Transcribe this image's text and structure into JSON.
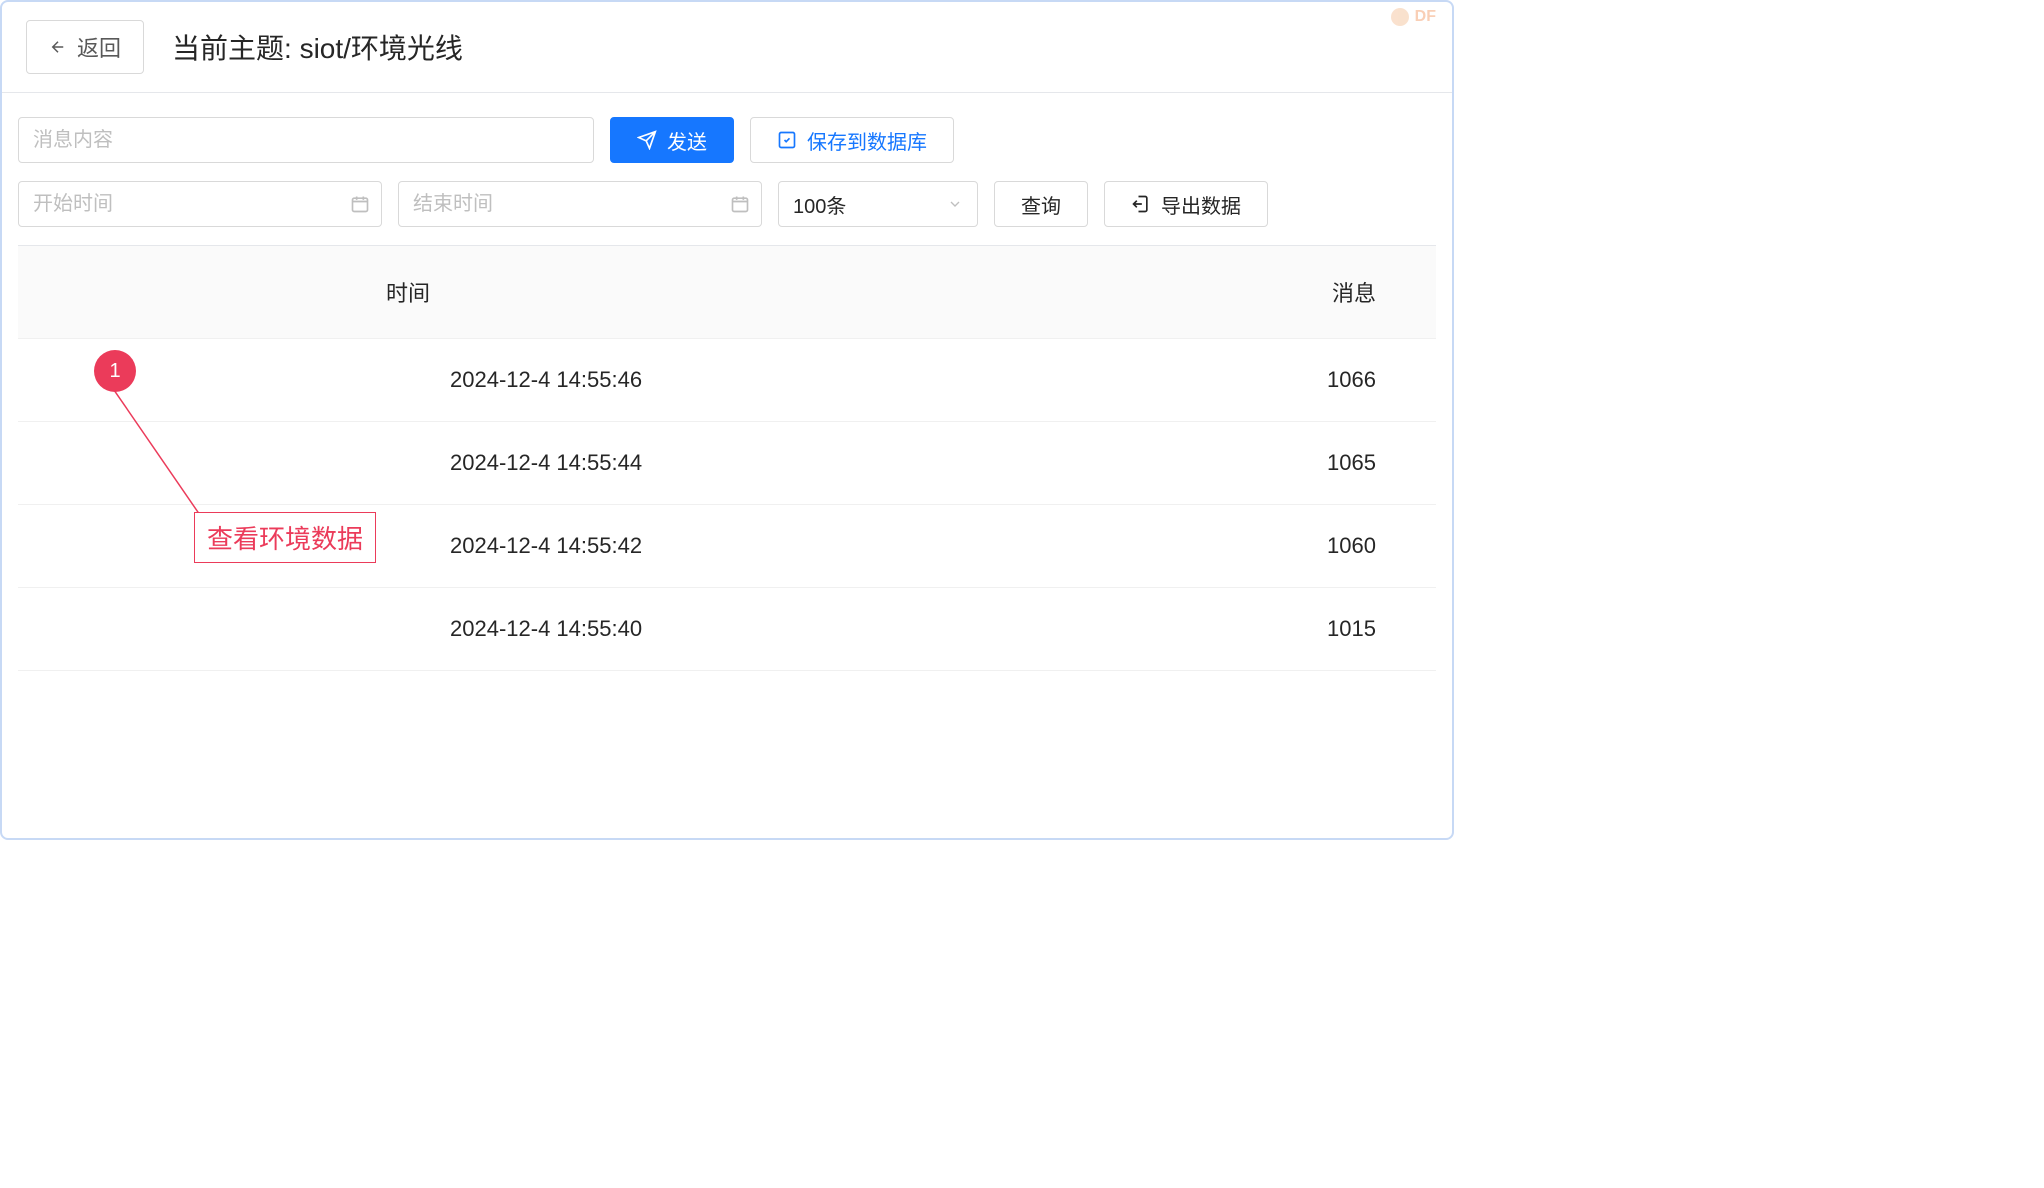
{
  "header": {
    "back_label": "返回",
    "topic_prefix": "当前主题: ",
    "topic_value": "siot/环境光线"
  },
  "watermark": {
    "text": "DF"
  },
  "controls": {
    "message_placeholder": "消息内容",
    "send_label": "发送",
    "save_db_label": "保存到数据库",
    "start_time_placeholder": "开始时间",
    "end_time_placeholder": "结束时间",
    "limit_selected": "100条",
    "query_label": "查询",
    "export_label": "导出数据"
  },
  "table": {
    "columns": {
      "time": "时间",
      "message": "消息"
    },
    "rows": [
      {
        "time": "2024-12-4 14:55:46",
        "message": "1066"
      },
      {
        "time": "2024-12-4 14:55:44",
        "message": "1065"
      },
      {
        "time": "2024-12-4 14:55:42",
        "message": "1060"
      },
      {
        "time": "2024-12-4 14:55:40",
        "message": "1015"
      }
    ]
  },
  "annotation": {
    "badge": "1",
    "label": "查看环境数据"
  }
}
